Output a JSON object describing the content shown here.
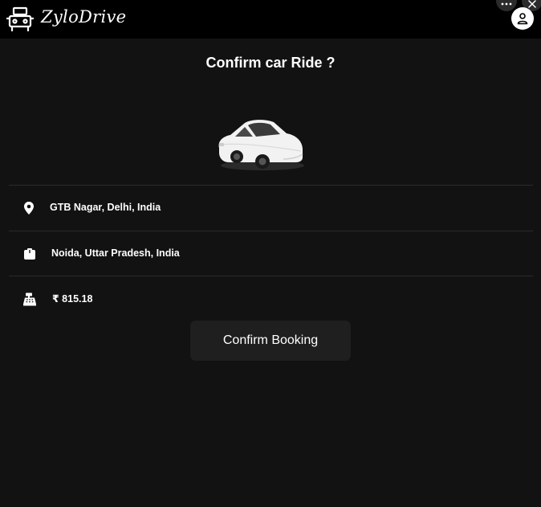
{
  "header": {
    "brand": "ZyloDrive"
  },
  "page": {
    "title": "Confirm car Ride ?"
  },
  "ride": {
    "pickup": "GTB Nagar, Delhi, India",
    "destination": "Noida, Uttar Pradesh, India",
    "fare": "₹ 815.18"
  },
  "actions": {
    "confirm_label": "Confirm Booking"
  }
}
